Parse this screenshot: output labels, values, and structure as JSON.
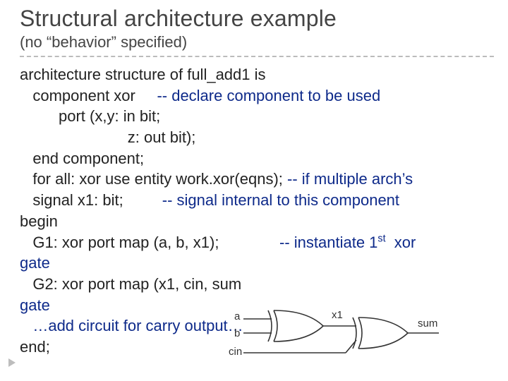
{
  "header": {
    "title": "Structural architecture example",
    "subtitle": "(no “behavior” specified)"
  },
  "code": {
    "l01": "architecture structure of full_add1 is",
    "l02_a": "   component xor     ",
    "l02_b": "-- declare component to be used",
    "l03": "         port (x,y: in bit;",
    "l04": "                         z: out bit);",
    "l05": "   end component;",
    "l06_a": "   for all: xor use entity work.xor(eqns); ",
    "l06_b": "-- if multiple arch’s",
    "l07_a": "   signal x1: bit;         ",
    "l07_b": "-- signal internal to this component",
    "l08": "begin",
    "l09_a": "   G1: xor port map (a, b, x1);              ",
    "l09_b_pre": "-- instantiate 1",
    "l09_b_sup": "st",
    "l09_b_post": "  xor",
    "l10": "gate",
    "l11": "   G2: xor port map (x1, cin, sum",
    "l12": "gate",
    "l13": "   …add circuit for carry output…",
    "l14": "end;"
  },
  "schematic": {
    "labels": {
      "a": "a",
      "b": "b",
      "cin": "cin",
      "x1": "x1",
      "sum": "sum"
    }
  }
}
